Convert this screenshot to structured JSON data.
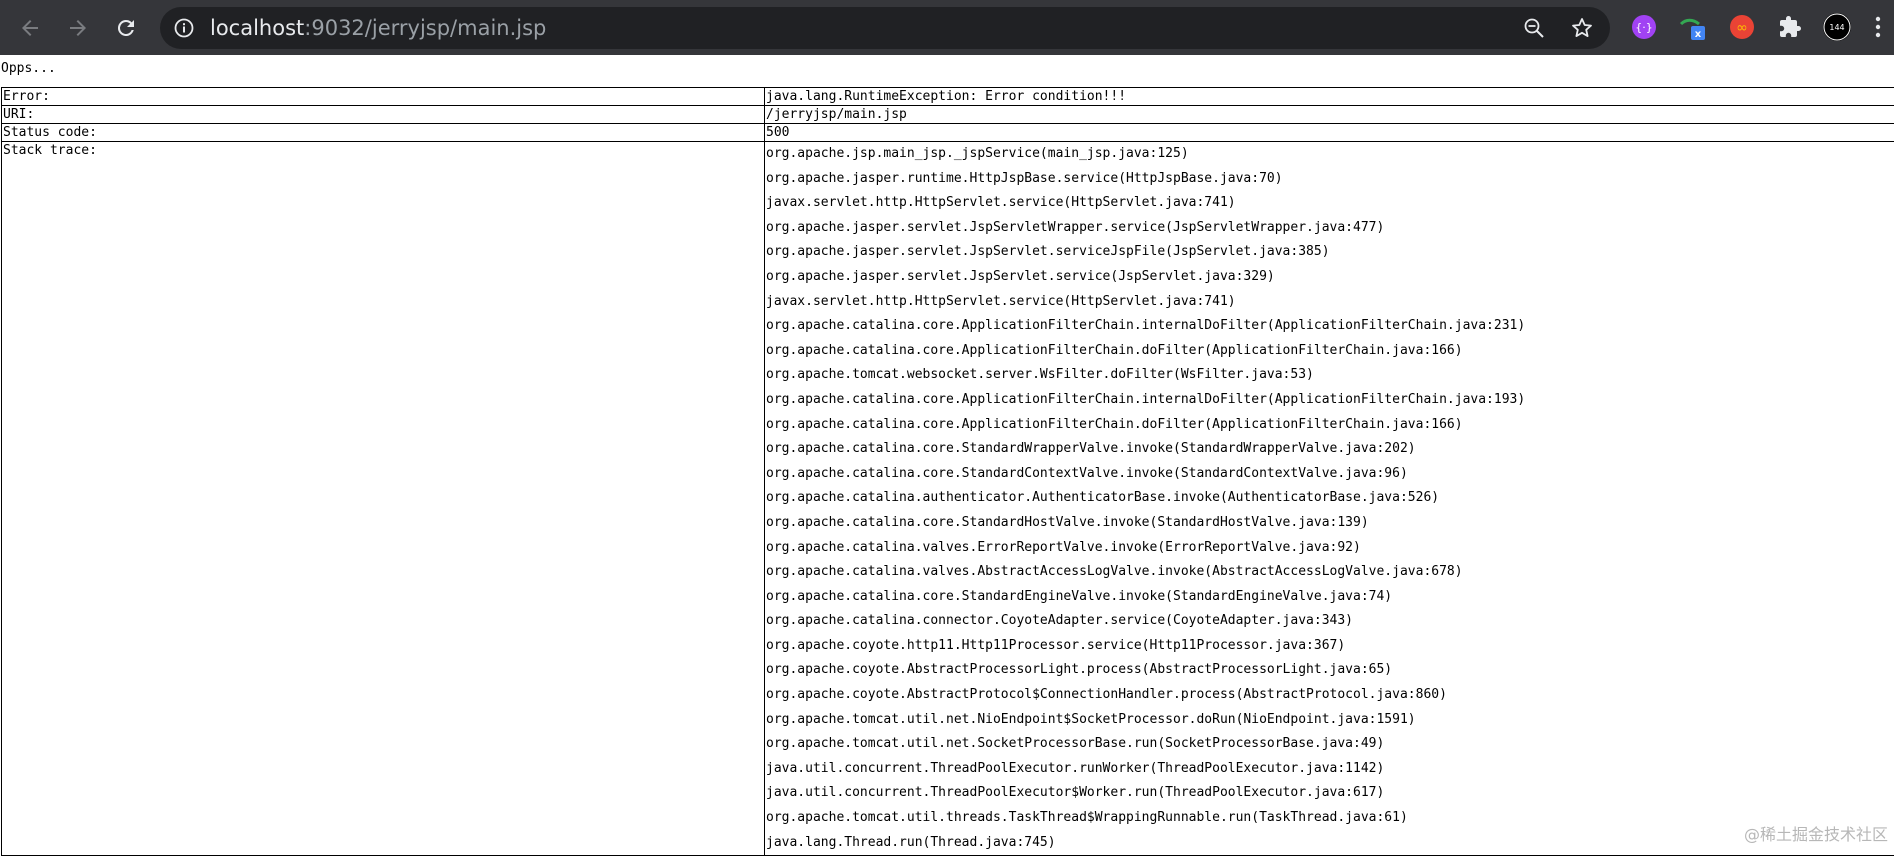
{
  "browser": {
    "url_host": "localhost",
    "url_path": ":9032/jerryjsp/main.jsp",
    "icons": {
      "back": "arrow-left-icon",
      "forward": "arrow-right-icon",
      "reload": "reload-icon",
      "info": "info-icon",
      "zoom": "zoom-out-icon",
      "bookmark": "star-icon"
    },
    "extension_badge": "144"
  },
  "page": {
    "heading": "Opps...",
    "rows": [
      {
        "label": "Error:",
        "value": "java.lang.RuntimeException: Error condition!!!"
      },
      {
        "label": "URI:",
        "value": "/jerryjsp/main.jsp"
      },
      {
        "label": "Status code:",
        "value": "500"
      }
    ],
    "stack_label": "Stack trace:",
    "stack_trace": [
      "org.apache.jsp.main_jsp._jspService(main_jsp.java:125)",
      "org.apache.jasper.runtime.HttpJspBase.service(HttpJspBase.java:70)",
      "javax.servlet.http.HttpServlet.service(HttpServlet.java:741)",
      "org.apache.jasper.servlet.JspServletWrapper.service(JspServletWrapper.java:477)",
      "org.apache.jasper.servlet.JspServlet.serviceJspFile(JspServlet.java:385)",
      "org.apache.jasper.servlet.JspServlet.service(JspServlet.java:329)",
      "javax.servlet.http.HttpServlet.service(HttpServlet.java:741)",
      "org.apache.catalina.core.ApplicationFilterChain.internalDoFilter(ApplicationFilterChain.java:231)",
      "org.apache.catalina.core.ApplicationFilterChain.doFilter(ApplicationFilterChain.java:166)",
      "org.apache.tomcat.websocket.server.WsFilter.doFilter(WsFilter.java:53)",
      "org.apache.catalina.core.ApplicationFilterChain.internalDoFilter(ApplicationFilterChain.java:193)",
      "org.apache.catalina.core.ApplicationFilterChain.doFilter(ApplicationFilterChain.java:166)",
      "org.apache.catalina.core.StandardWrapperValve.invoke(StandardWrapperValve.java:202)",
      "org.apache.catalina.core.StandardContextValve.invoke(StandardContextValve.java:96)",
      "org.apache.catalina.authenticator.AuthenticatorBase.invoke(AuthenticatorBase.java:526)",
      "org.apache.catalina.core.StandardHostValve.invoke(StandardHostValve.java:139)",
      "org.apache.catalina.valves.ErrorReportValve.invoke(ErrorReportValve.java:92)",
      "org.apache.catalina.valves.AbstractAccessLogValve.invoke(AbstractAccessLogValve.java:678)",
      "org.apache.catalina.core.StandardEngineValve.invoke(StandardEngineValve.java:74)",
      "org.apache.catalina.connector.CoyoteAdapter.service(CoyoteAdapter.java:343)",
      "org.apache.coyote.http11.Http11Processor.service(Http11Processor.java:367)",
      "org.apache.coyote.AbstractProcessorLight.process(AbstractProcessorLight.java:65)",
      "org.apache.coyote.AbstractProtocol$ConnectionHandler.process(AbstractProtocol.java:860)",
      "org.apache.tomcat.util.net.NioEndpoint$SocketProcessor.doRun(NioEndpoint.java:1591)",
      "org.apache.tomcat.util.net.SocketProcessorBase.run(SocketProcessorBase.java:49)",
      "java.util.concurrent.ThreadPoolExecutor.runWorker(ThreadPoolExecutor.java:1142)",
      "java.util.concurrent.ThreadPoolExecutor$Worker.run(ThreadPoolExecutor.java:617)",
      "org.apache.tomcat.util.threads.TaskThread$WrappingRunnable.run(TaskThread.java:61)",
      "java.lang.Thread.run(Thread.java:745)"
    ],
    "watermark": "@稀土掘金技术社区"
  },
  "colors": {
    "chrome_bg": "#35363a",
    "omnibox_bg": "#202124",
    "url_host": "#e8eaed",
    "url_path": "#9aa0a6"
  }
}
